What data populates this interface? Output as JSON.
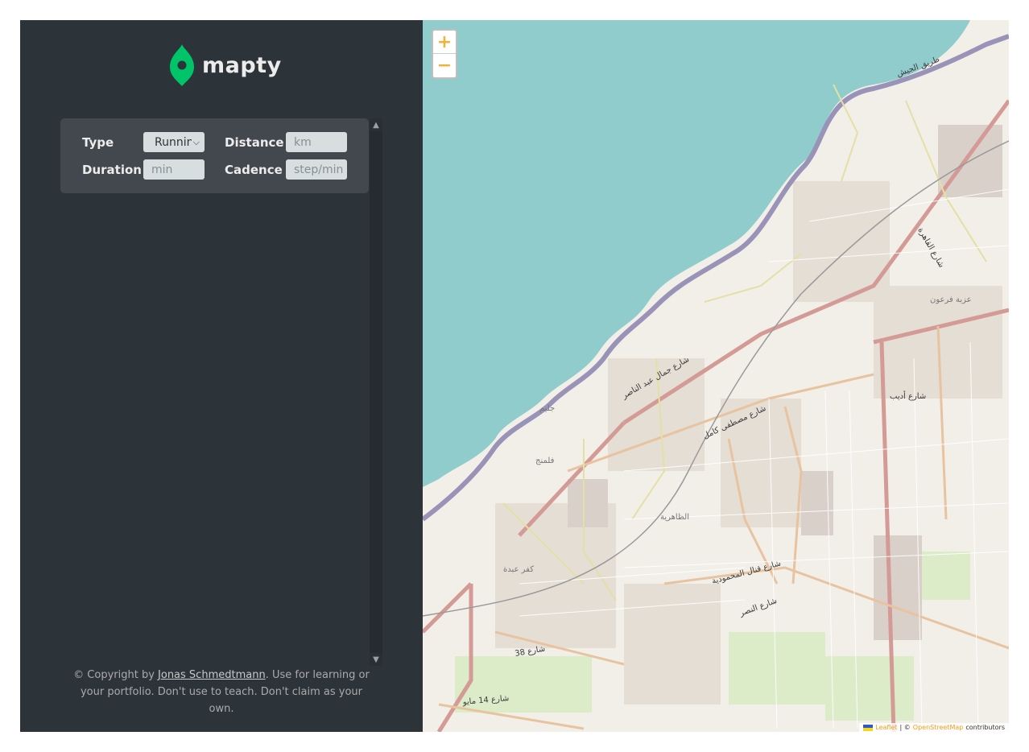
{
  "app": {
    "logo_text": "mapty"
  },
  "form": {
    "type_label": "Type",
    "type_value": "Running",
    "distance_label": "Distance",
    "distance_placeholder": "km",
    "duration_label": "Duration",
    "duration_placeholder": "min",
    "cadence_label": "Cadence",
    "cadence_placeholder": "step/min"
  },
  "footer": {
    "prefix": "© Copyright by ",
    "author": "Jonas Schmedtmann",
    "suffix": ". Use for learning or your portfolio. Don't use to teach. Don't claim as your own."
  },
  "map": {
    "zoom_in": "+",
    "zoom_out": "−",
    "attribution_leaflet": "Leaflet",
    "attribution_sep": "| ©",
    "attribution_osm": "OpenStreetMap",
    "attribution_suffix": "contributors",
    "labels": [
      "طريق الجيش",
      "شارع جمال عبد الناصر",
      "شارع مصطفى كامل",
      "شارع أديب",
      "الظاهرية",
      "كفر عبدة",
      "فلمنج",
      "جليم",
      "شارع 38",
      "شارع 14 مايو",
      "شارع النصر",
      "شارع قنال المحمودية",
      "عزبة فرعون",
      "شارع القاهرة"
    ]
  },
  "colors": {
    "sidebar": "#2d3439",
    "form": "#42484d",
    "accent": "#00c46a",
    "sea": "#8fcccb",
    "land": "#f2efe9"
  }
}
